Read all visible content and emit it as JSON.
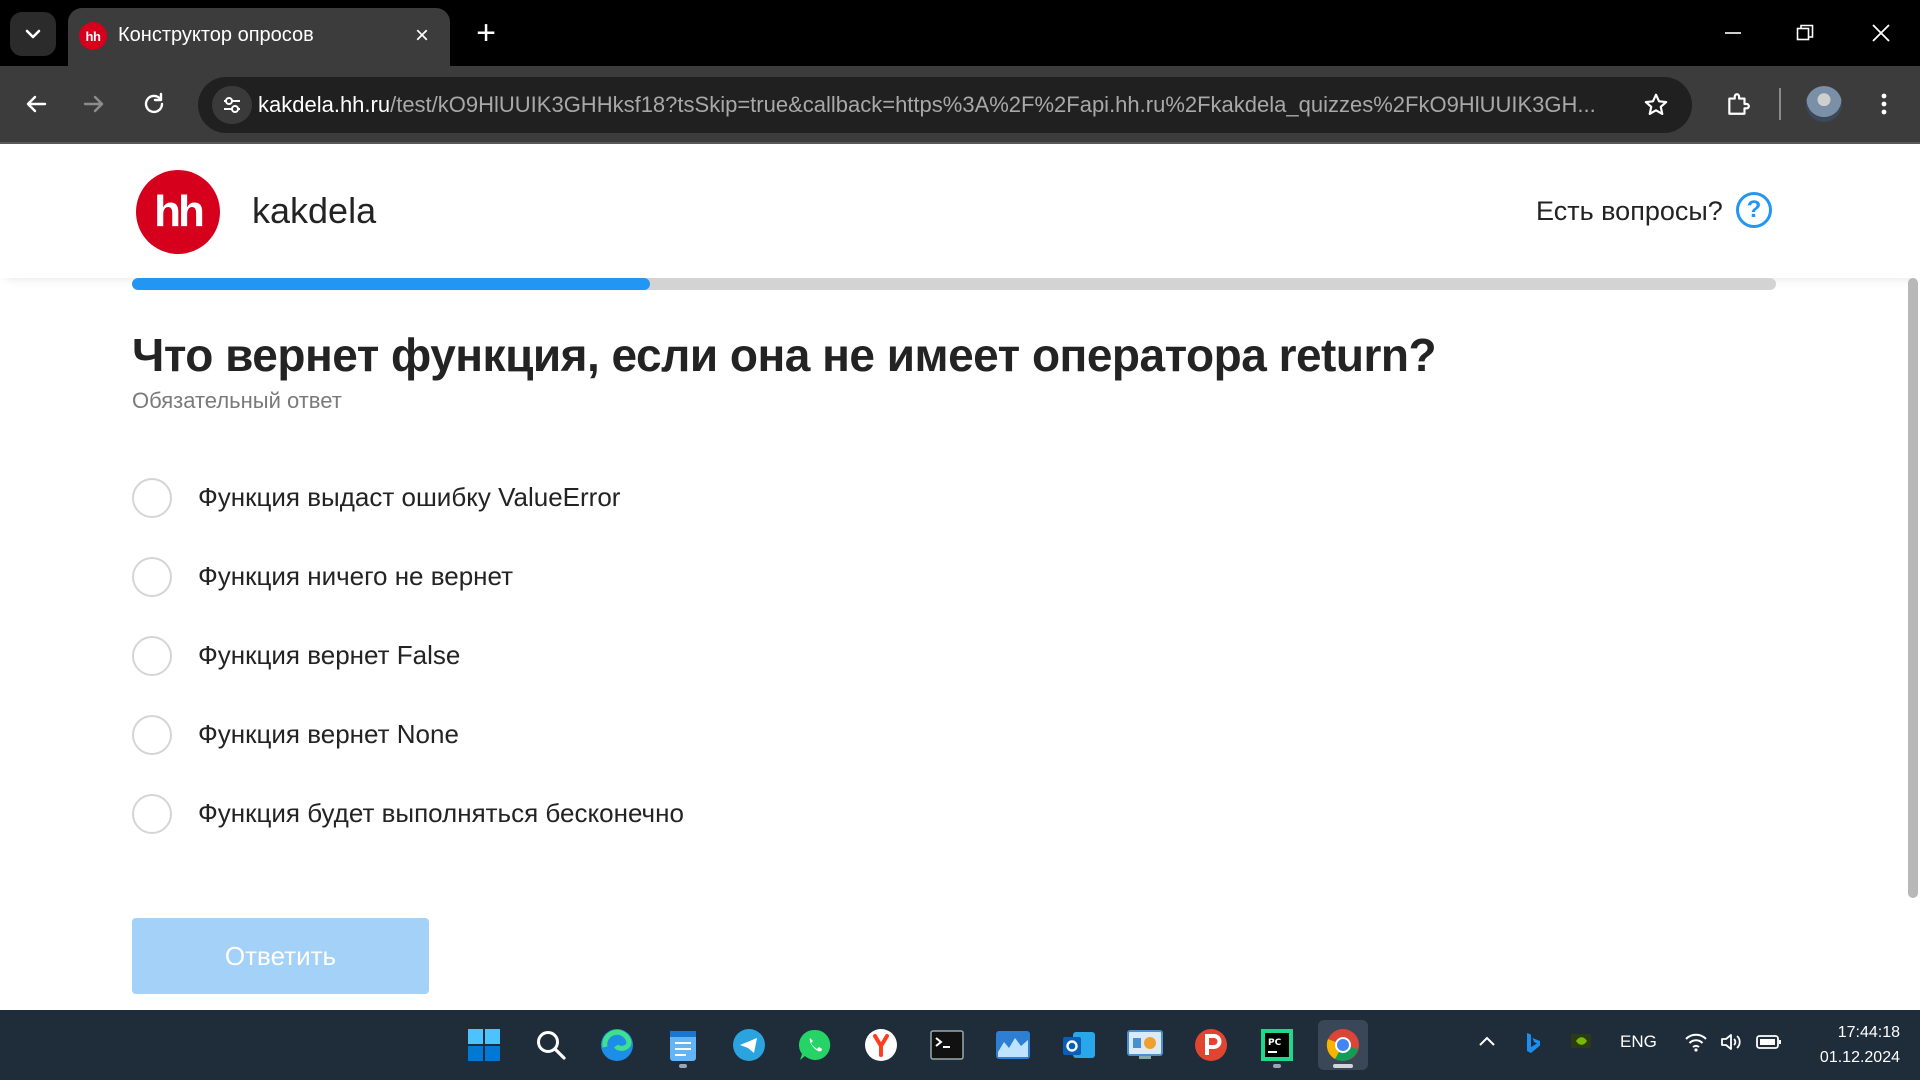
{
  "browser": {
    "tab_title": "Конструктор опросов",
    "tab_favicon_text": "hh",
    "url_host": "kakdela.hh.ru",
    "url_path": "/test/kO9HlUUIK3GHHksf18?tsSkip=true&callback=https%3A%2F%2Fapi.hh.ru%2Fkakdela_quizzes%2FkO9HlUUIK3GH..."
  },
  "header": {
    "logo_text": "hh",
    "brand": "kakdela",
    "help_text": "Есть вопросы?",
    "help_icon_text": "?"
  },
  "progress": {
    "fraction": 0.315
  },
  "question": {
    "title": "Что вернет функция, если она не имеет оператора return?",
    "required_note": "Обязательный ответ",
    "options": [
      "Функция выдаст ошибку ValueError",
      "Функция ничего не вернет",
      "Функция вернет False",
      "Функция вернет None",
      "Функция будет выполняться бесконечно"
    ]
  },
  "submit_label": "Ответить",
  "colors": {
    "brand_red": "#d6001c",
    "accent_blue": "#2196f3",
    "submit_disabled": "#a3d1f8"
  },
  "taskbar": {
    "apps": [
      "windows-start",
      "search",
      "edge",
      "notepad",
      "telegram",
      "whatsapp",
      "yandex",
      "terminal",
      "resource-monitor",
      "outlook",
      "control-panel",
      "pomodoro",
      "pycharm",
      "chrome"
    ],
    "language": "ENG",
    "time": "17:44:18",
    "date": "01.12.2024"
  }
}
